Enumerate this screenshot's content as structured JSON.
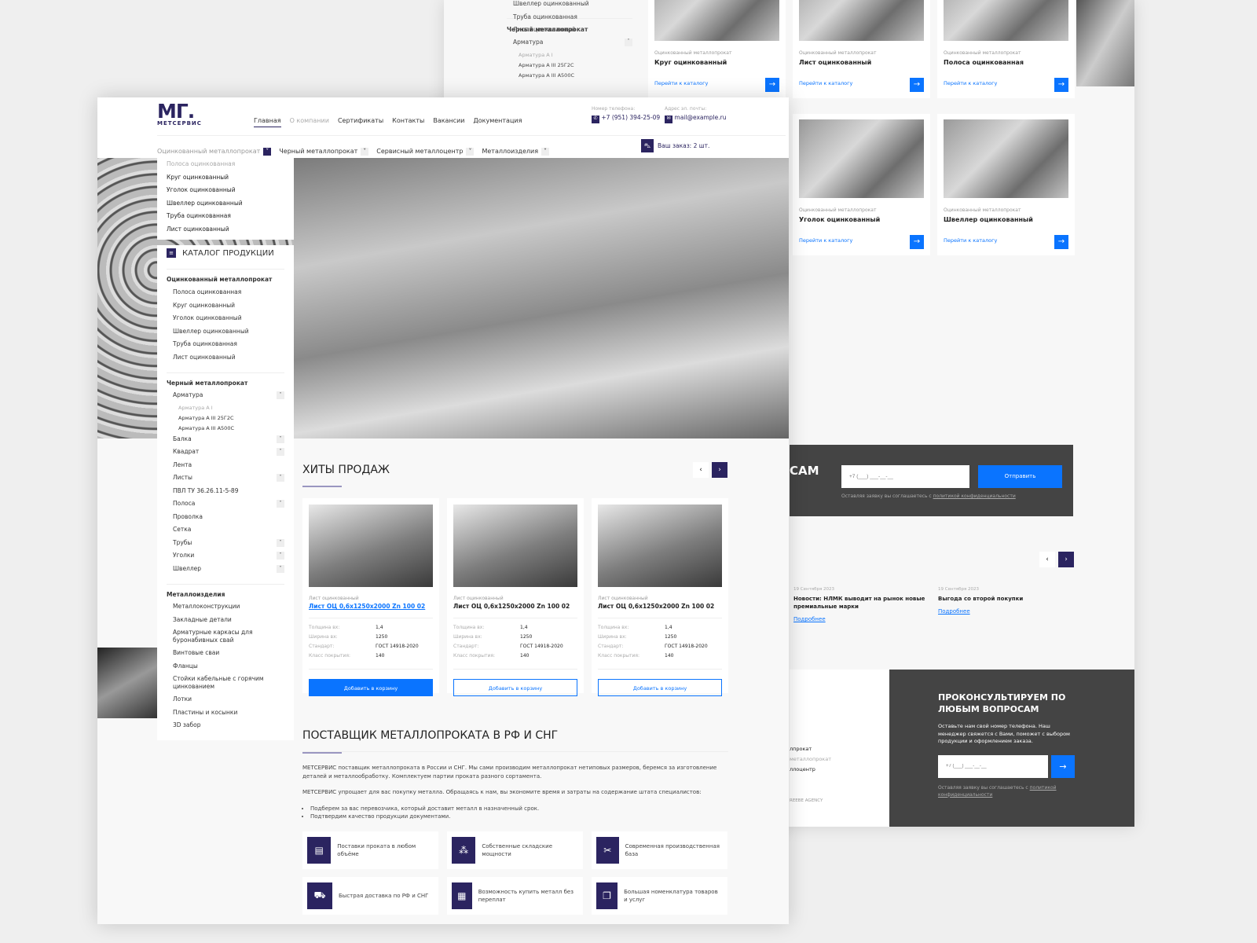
{
  "back": {
    "sidebar_top": [
      "Швеллер оцинкованный",
      "Труба оцинкованная",
      "Лист оцинкованный"
    ],
    "sidebar_header": "Черный металлопрокат",
    "sidebar_armatura": "Арматура",
    "sidebar_sub": [
      "Арматура А I",
      "Арматура А III 25Г2С",
      "Арматура А III А500С"
    ],
    "products": [
      {
        "category": "Оцинкованный металлопрокат",
        "name": "Круг оцинкованный",
        "link": "Перейти к каталогу"
      },
      {
        "category": "Оцинкованный металлопрокат",
        "name": "Лист оцинкованный",
        "link": "Перейти к каталогу"
      },
      {
        "category": "Оцинкованный металлопрокат",
        "name": "Полоса оцинкованная",
        "link": "Перейти к каталогу"
      },
      {
        "category": "Оцинкованный металлопрокат",
        "name": "Уголок оцинкованный",
        "link": "Перейти к каталогу"
      },
      {
        "category": "Оцинкованный металлопрокат",
        "name": "Швеллер оцинкованный",
        "link": "Перейти к каталогу"
      }
    ],
    "form": {
      "title_fragment": "САМ",
      "placeholder": "+7 (___) ___-__-__",
      "submit": "Отправить",
      "note": "Оставляя заявку вы соглашаетесь с ",
      "note_link": "политикой конфиденциальности"
    },
    "news": [
      {
        "date": "19 Сентября 2023",
        "title": "Новости: НЛМК выводит на рынок новые премиальные марки",
        "link": "Подробнее"
      },
      {
        "date": "19 Сентября 2023",
        "title": "Выгода со второй покупки",
        "link": "Подробнее"
      }
    ],
    "footer_links": [
      "лпрокат",
      "металлопрокат",
      "ллоцентр"
    ],
    "footer_credit": "REEBE AGENCY",
    "consult": {
      "title": "ПРОКОНСУЛЬТИРУЕМ ПО ЛЮБЫМ ВОПРОСАМ",
      "text": "Оставьте нам свой номер телефона. Наш менеджер свяжется с Вами, поможет с выбором продукции и оформлением заказа.",
      "placeholder": "+7 (___) ___-__-__",
      "note": "Оставляя заявку вы соглашаетесь с ",
      "note_link": "политикой конфиденциальности"
    }
  },
  "header": {
    "logo": "МГ. МЕТСЕРВИС",
    "nav": [
      "Главная",
      "О компании",
      "Сертификаты",
      "Контакты",
      "Вакансии",
      "Документация"
    ],
    "phone_label": "Номер телефона:",
    "phone": "+7 (951) 394-25-09",
    "email_label": "Адрес эл. почты:",
    "email": "mail@example.ru",
    "catnav": [
      "Оцинкованный металлопрокат",
      "Черный металлопрокат",
      "Сервисный металлоцентр",
      "Металлоизделия"
    ],
    "cart_label": "Ваш заказ:",
    "cart_count": "2 шт."
  },
  "dropdown": [
    "Полоса оцинкованная",
    "Круг оцинкованный",
    "Уголок оцинкованный",
    "Швеллер оцинкованный",
    "Труба оцинкованная",
    "Лист оцинкованный"
  ],
  "catalog": {
    "title": "КАТАЛОГ ПРОДУКЦИИ",
    "groups": [
      {
        "header": "Оцинкованный металлопрокат",
        "items": [
          {
            "l": "Полоса оцинкованная"
          },
          {
            "l": "Круг оцинкованный"
          },
          {
            "l": "Уголок оцинкованный"
          },
          {
            "l": "Швеллер оцинкованный"
          },
          {
            "l": "Труба оцинкованная"
          },
          {
            "l": "Лист оцинкованный"
          }
        ]
      },
      {
        "header": "Черный металлопрокат",
        "items": [
          {
            "l": "Арматура",
            "t": "up",
            "sub": [
              "Арматура А I",
              "Арматура А III 25Г2С",
              "Арматура А III А500С"
            ]
          },
          {
            "l": "Балка",
            "t": "down"
          },
          {
            "l": "Квадрат",
            "t": "down"
          },
          {
            "l": "Лента"
          },
          {
            "l": "Листы",
            "t": "down"
          },
          {
            "l": "ПВЛ ТУ 36.26.11-5-89"
          },
          {
            "l": "Полоса",
            "t": "down"
          },
          {
            "l": "Проволка"
          },
          {
            "l": "Сетка"
          },
          {
            "l": "Трубы",
            "t": "down"
          },
          {
            "l": "Уголки",
            "t": "down"
          },
          {
            "l": "Швеллер",
            "t": "down"
          }
        ]
      },
      {
        "header": "Металлоизделия",
        "items": [
          {
            "l": "Металлоконструкции"
          },
          {
            "l": "Закладные детали"
          },
          {
            "l": "Арматурные каркасы для буронабивных свай"
          },
          {
            "l": "Винтовые сваи"
          },
          {
            "l": "Фланцы"
          },
          {
            "l": "Стойки кабельные с горячим цинкованием"
          },
          {
            "l": "Лотки"
          },
          {
            "l": "Пластины и косынки"
          },
          {
            "l": "3D забор"
          }
        ]
      }
    ]
  },
  "hits": {
    "title": "ХИТЫ ПРОДАЖ",
    "spec_labels": [
      "Толщина вх:",
      "Ширина вх:",
      "Стандарт:",
      "Класс покрытия:"
    ],
    "cards": [
      {
        "category": "Лист оцинкованный",
        "name": "Лист ОЦ 0,6x1250x2000 Zn 100 02",
        "specs": [
          "1,4",
          "1250",
          "ГОСТ 14918-2020",
          "140"
        ],
        "button": "Добавить в корзину"
      },
      {
        "category": "Лист оцинкованный",
        "name": "Лист ОЦ 0,6x1250x2000 Zn 100 02",
        "specs": [
          "1,4",
          "1250",
          "ГОСТ 14918-2020",
          "140"
        ],
        "button": "Добавить в корзину"
      },
      {
        "category": "Лист оцинкованный",
        "name": "Лист ОЦ 0,6x1250x2000 Zn 100 02",
        "specs": [
          "1,4",
          "1250",
          "ГОСТ 14918-2020",
          "140"
        ],
        "button": "Добавить в корзину"
      }
    ]
  },
  "about": {
    "title": "ПОСТАВЩИК МЕТАЛЛОПРОКАТА В РФ И СНГ",
    "p1": "МЕТСЕРВИС поставщик металлопроката в России и СНГ. Мы сами производим металлопрокат нетиповых размеров, беремся за изготовление деталей и металлообработку. Комплектуем партии проката разного сортамента.",
    "p2": "МЕТСЕРВИС упрощает для вас покупку металла. Обращаясь к нам, вы экономите время и затраты на содержание штата специалистов:",
    "bullets": [
      "Подберем за вас перевозчика, который доставит металл в назначенный срок.",
      "Подтвердим качество продукции документами."
    ],
    "features": [
      {
        "icon": "archive-icon",
        "glyph": "▤",
        "text": "Поставки проката в любом объёме"
      },
      {
        "icon": "warehouse-icon",
        "glyph": "⁂",
        "text": "Собственные складские мощности"
      },
      {
        "icon": "tools-icon",
        "glyph": "✂",
        "text": "Современная производственная база"
      },
      {
        "icon": "truck-icon",
        "glyph": "⛟",
        "text": "Быстрая доставка по РФ и СНГ"
      },
      {
        "icon": "calculator-icon",
        "glyph": "▦",
        "text": "Возможность купить металл без переплат"
      },
      {
        "icon": "documents-icon",
        "glyph": "❐",
        "text": "Большая номенклатура товаров и услуг"
      }
    ]
  },
  "colors": {
    "accent": "#0a74ff",
    "brand": "#2b2460",
    "dark": "#444444"
  }
}
